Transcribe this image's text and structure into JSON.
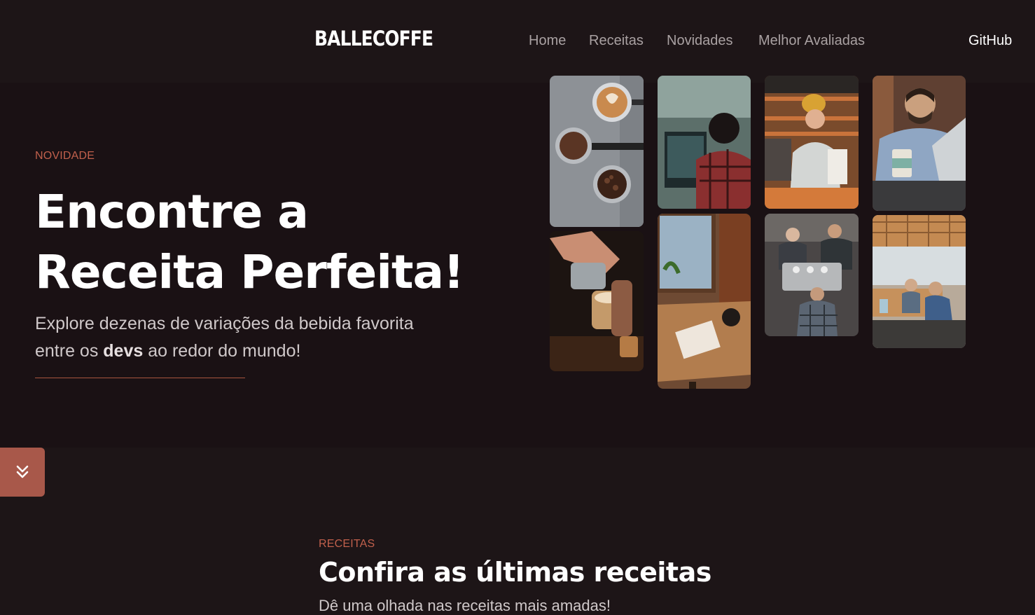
{
  "header": {
    "logo": "BALLECOFFE",
    "nav": [
      "Home",
      "Receitas",
      "Novidades",
      "Melhor Avaliadas"
    ],
    "github": "GitHub"
  },
  "hero": {
    "kicker": "NOVIDADE",
    "title_line1": "Encontre a",
    "title_line2": "Receita Perfeita!",
    "desc_part1": "Explore dezenas de variações da bebida favorita entre os ",
    "desc_bold": "devs",
    "desc_part2": " ao redor do mundo!",
    "images": [
      "latte-art-portafilters-image",
      "developer-coding-cafe-image",
      "barista-smiling-image",
      "man-laptop-coffee-image",
      "latte-pour-image",
      "cafe-window-table-image",
      "baristas-espresso-machine-image",
      "office-team-meeting-image"
    ]
  },
  "scroll_button": {
    "icon": "chevrons-down-icon"
  },
  "recipes": {
    "kicker": "RECEITAS",
    "title": "Confira as últimas receitas",
    "subtitle": "Dê uma olhada nas receitas mais amadas!"
  },
  "colors": {
    "background": "#1d1517",
    "hero_background": "#1a1114",
    "accent": "#c1604c",
    "button": "#a8584a"
  }
}
